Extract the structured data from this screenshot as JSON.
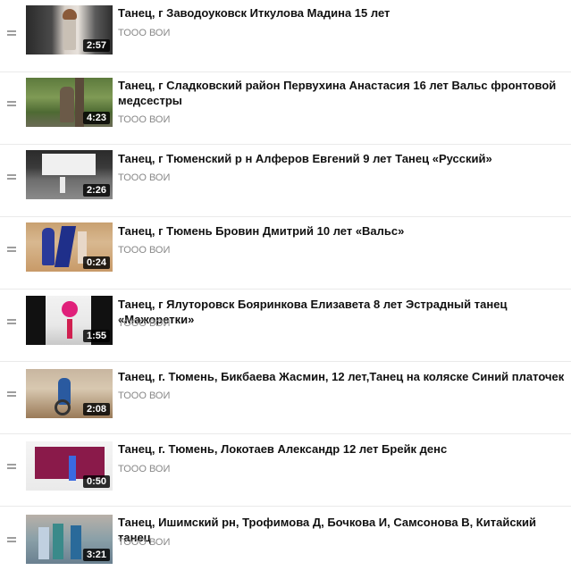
{
  "playlist": {
    "items": [
      {
        "title": "Танец, г Заводоуковск Иткулова Мадина 15 лет",
        "channel": "ТООО ВОИ",
        "duration": "2:57"
      },
      {
        "title": "Танец, г Сладковский район Первухина Анастасия 16 лет Вальс фронтовой медсестры",
        "channel": "ТООО ВОИ",
        "duration": "4:23"
      },
      {
        "title": "Танец, г Тюменский р н Алферов Евгений 9 лет Танец «Русский»",
        "channel": "ТООО ВОИ",
        "duration": "2:26"
      },
      {
        "title": "Танец, г Тюмень Бровин Дмитрий 10 лет «Вальс»",
        "channel": "ТООО ВОИ",
        "duration": "0:24"
      },
      {
        "title": "Танец, г Ялуторовск Бояринкова Елизавета 8 лет Эстрадный танец «Мажоретки»",
        "channel": "ТООО ВОИ",
        "duration": "1:55"
      },
      {
        "title": "Танец, г. Тюмень, Бикбаева Жасмин, 12 лет,Танец на коляске Синий платочек",
        "channel": "ТООО ВОИ",
        "duration": "2:08"
      },
      {
        "title": "Танец, г. Тюмень, Локотаев Александр 12 лет Брейк денс",
        "channel": "ТООО ВОИ",
        "duration": "0:50"
      },
      {
        "title": "Танец, Ишимский рн, Трофимова Д, Бочкова И, Самсонова В, Китайский танец",
        "channel": "ТООО ВОИ",
        "duration": "3:21"
      }
    ]
  }
}
